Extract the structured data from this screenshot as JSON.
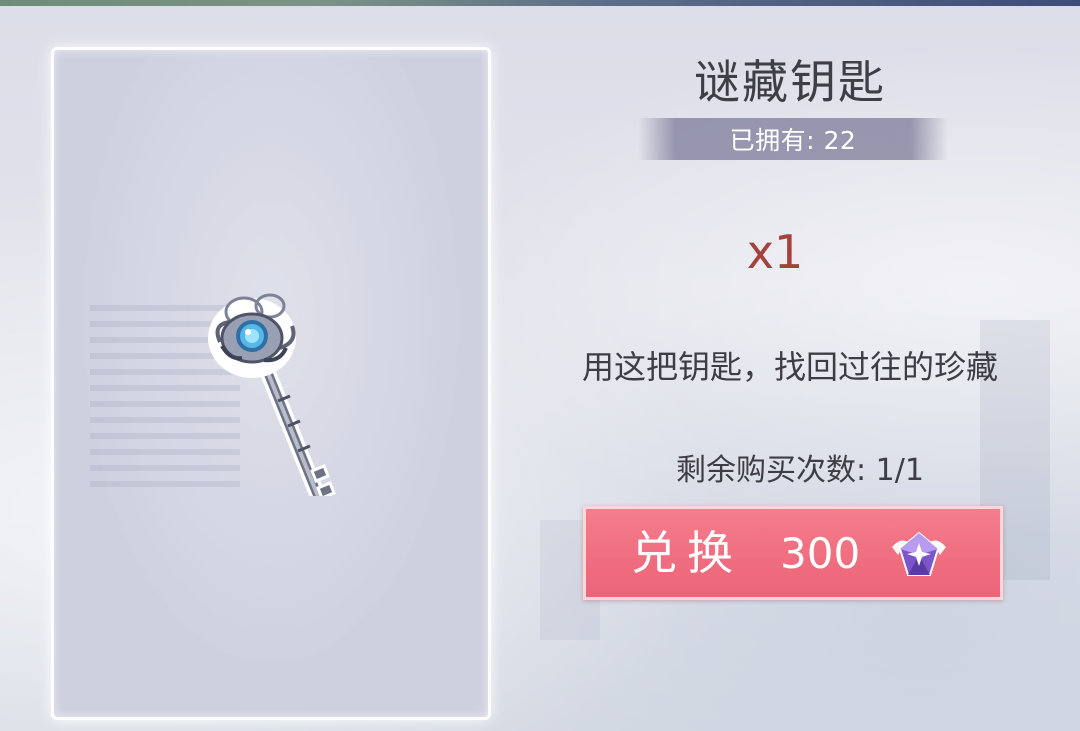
{
  "item": {
    "name": "谜藏钥匙",
    "owned": "已拥有: 22",
    "quantity": "x1",
    "description": "用这把钥匙，找回过往的珍藏",
    "remaining_purchases": "剩余购买次数: 1/1",
    "icon": "key-icon"
  },
  "exchange": {
    "label": "兑换",
    "price": "300",
    "currency_icon": "purple-gem-icon"
  },
  "colors": {
    "button": "#ef6d7e",
    "quantity": "#a2433d",
    "banner": "#6e6c8c"
  }
}
